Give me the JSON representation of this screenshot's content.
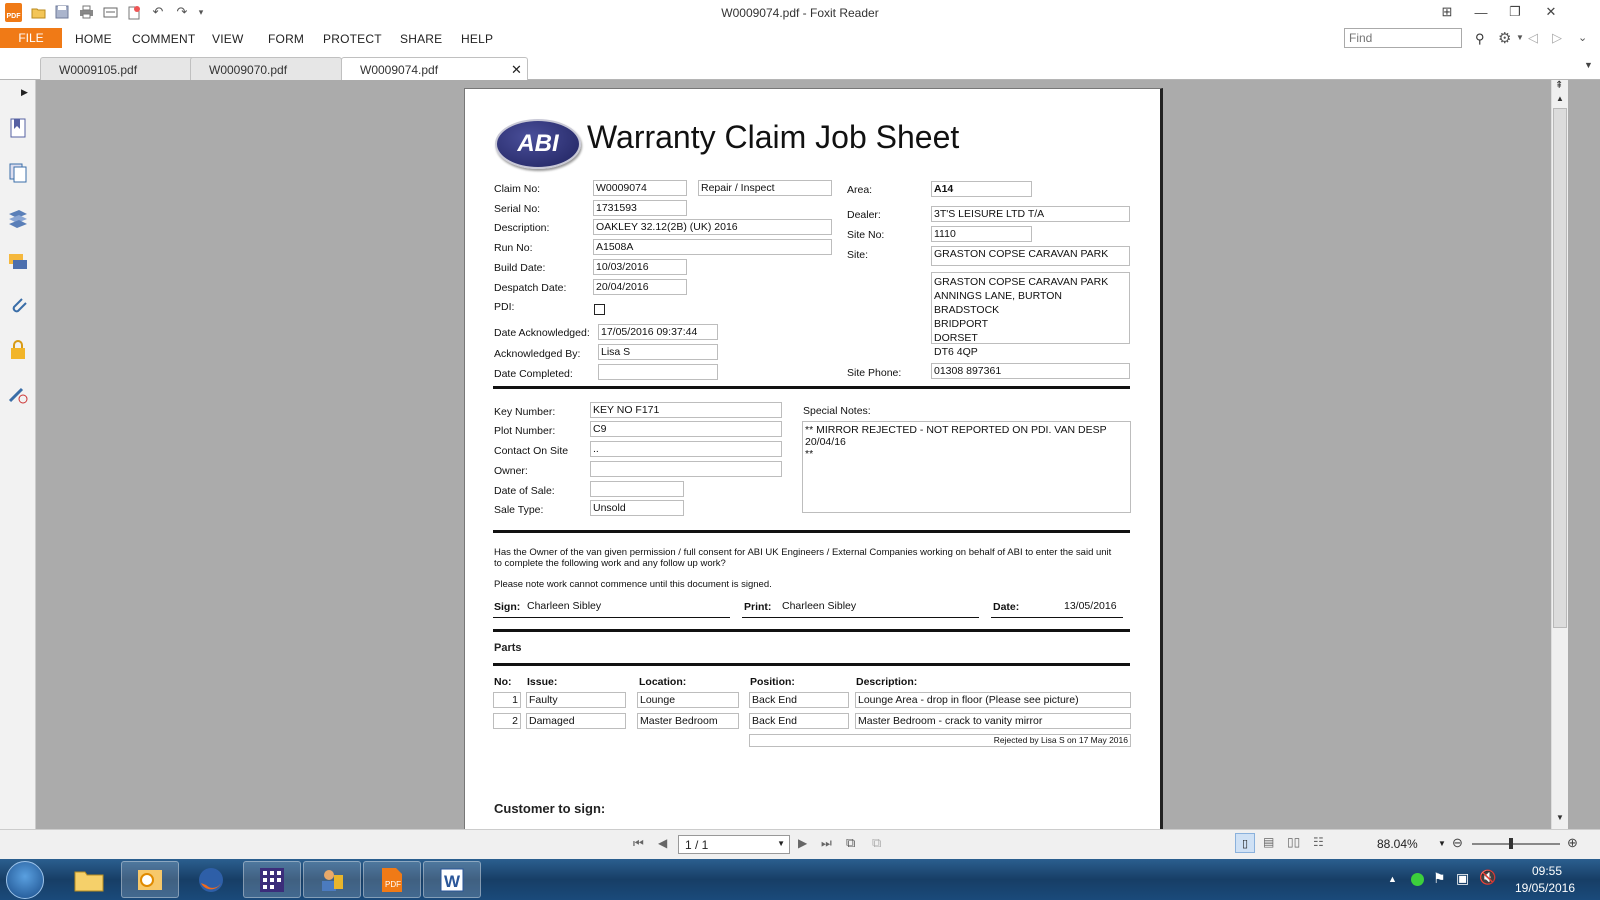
{
  "window": {
    "title": "W0009074.pdf - Foxit Reader"
  },
  "menu": {
    "file": "FILE",
    "items": [
      "HOME",
      "COMMENT",
      "VIEW",
      "FORM",
      "PROTECT",
      "SHARE",
      "HELP"
    ]
  },
  "find": {
    "placeholder": "Find"
  },
  "tabs": [
    {
      "label": "W0009105.pdf"
    },
    {
      "label": "W0009070.pdf"
    },
    {
      "label": "W0009074.pdf",
      "active": true
    }
  ],
  "doc": {
    "title": "Warranty Claim Job Sheet",
    "logo_text": "ABI",
    "left_fields": [
      {
        "label": "Claim No:",
        "value": "W0009074"
      },
      {
        "label": "Serial No:",
        "value": "1731593"
      },
      {
        "label": "Description:",
        "value": "OAKLEY 32.12(2B) (UK) 2016"
      },
      {
        "label": "Run No:",
        "value": "A1508A"
      },
      {
        "label": "Build Date:",
        "value": "10/03/2016"
      },
      {
        "label": "Despatch Date:",
        "value": "20/04/2016"
      },
      {
        "label": "PDI:",
        "value": ""
      }
    ],
    "claim_type": "Repair / Inspect",
    "ack": [
      {
        "label": "Date Acknowledged:",
        "value": "17/05/2016 09:37:44"
      },
      {
        "label": "Acknowledged By:",
        "value": "Lisa S"
      },
      {
        "label": "Date Completed:",
        "value": ""
      }
    ],
    "right_fields": [
      {
        "label": "Area:",
        "value": "A14"
      },
      {
        "label": "Dealer:",
        "value": "3T'S LEISURE LTD T/A"
      },
      {
        "label": "Site No:",
        "value": "1110"
      },
      {
        "label": "Site:",
        "value": "GRASTON COPSE CARAVAN PARK"
      }
    ],
    "address": [
      "GRASTON COPSE CARAVAN PARK",
      "ANNINGS LANE, BURTON BRADSTOCK",
      "BRIDPORT",
      "DORSET",
      "DT6 4QP"
    ],
    "site_phone": {
      "label": "Site Phone:",
      "value": "01308 897361"
    },
    "key_fields": [
      {
        "label": "Key Number:",
        "value": "KEY NO F171"
      },
      {
        "label": "Plot Number:",
        "value": "C9"
      },
      {
        "label": "Contact On Site",
        "value": ".."
      },
      {
        "label": "Owner:",
        "value": ""
      },
      {
        "label": "Date of Sale:",
        "value": ""
      },
      {
        "label": "Sale Type:",
        "value": "Unsold"
      }
    ],
    "special_notes": {
      "label": "Special Notes:",
      "line1": "** MIRROR REJECTED - NOT REPORTED ON PDI. VAN DESP 20/04/16",
      "line2": "**"
    },
    "consent_line1": "Has the Owner of the van given permission / full consent for ABI UK Engineers / External Companies working on behalf of ABI to enter the said unit",
    "consent_line2": "to complete the following work and any follow up work?",
    "notice": "Please note work cannot commence until this document is signed.",
    "sign": {
      "sign_label": "Sign:",
      "sign_value": "Charleen Sibley",
      "print_label": "Print:",
      "print_value": "Charleen Sibley",
      "date_label": "Date:",
      "date_value": "13/05/2016"
    },
    "parts_title": "Parts",
    "parts_headers": [
      "No:",
      "Issue:",
      "Location:",
      "Position:",
      "Description:"
    ],
    "parts": [
      {
        "no": "1",
        "issue": "Faulty",
        "location": "Lounge",
        "position": "Back End",
        "description": "Lounge Area - drop in floor (Please see picture)"
      },
      {
        "no": "2",
        "issue": "Damaged",
        "location": "Master Bedroom",
        "position": "Back End",
        "description": "Master Bedroom - crack to vanity mirror"
      }
    ],
    "rejected_note": "Rejected by Lisa S on 17 May 2016",
    "customer_sign": "Customer to sign:"
  },
  "status": {
    "page": "1 / 1",
    "zoom": "88.04%"
  },
  "clock": {
    "time": "09:55",
    "date": "19/05/2016"
  }
}
